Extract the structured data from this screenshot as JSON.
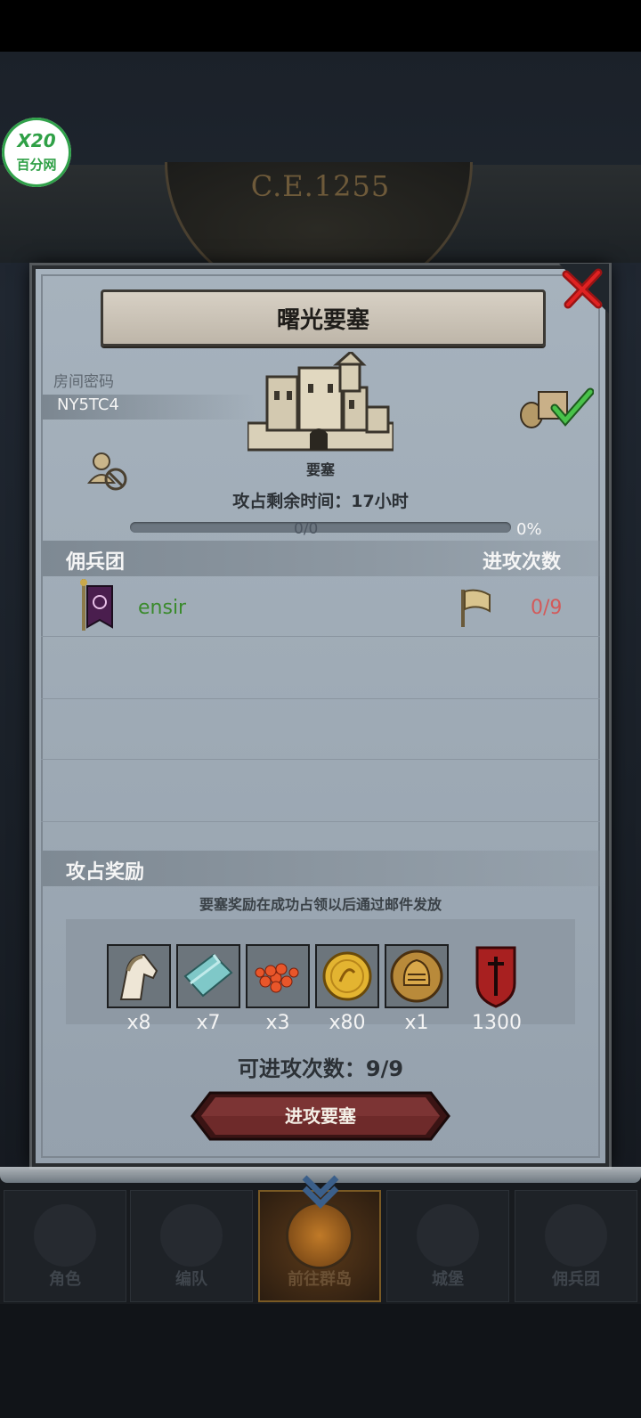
{
  "watermark": {
    "line1": "X20",
    "line2": "百分网"
  },
  "header": {
    "year": "C.E.1255"
  },
  "dialog": {
    "title": "曙光要塞",
    "room_label": "房间密码",
    "room_code": "NY5TC4",
    "building_label": "要塞",
    "time_remaining": "攻占剩余时间：17小时",
    "progress_text": "0/0",
    "progress_percent": "0%",
    "progress_value": 0,
    "mercenary_header": "佣兵团",
    "attack_count_header": "进攻次数",
    "mercenaries": [
      {
        "name": "ensir",
        "attacks": "0/9"
      }
    ],
    "reward_header": "攻占奖励",
    "reward_note": "要塞奖励在成功占领以后通过邮件发放",
    "rewards": [
      {
        "icon": "horse-icon",
        "qty": "x8"
      },
      {
        "icon": "cloth-icon",
        "qty": "x7"
      },
      {
        "icon": "caviar-icon",
        "qty": "x3"
      },
      {
        "icon": "gold-coin-icon",
        "qty": "x80"
      },
      {
        "icon": "helmet-icon",
        "qty": "x1"
      },
      {
        "icon": "shield-badge-icon",
        "qty": "1300"
      }
    ],
    "attacks_available": "可进攻次数：9/9",
    "attack_button": "进攻要塞"
  },
  "nav": [
    {
      "label": "角色",
      "active": false
    },
    {
      "label": "编队",
      "active": false
    },
    {
      "label": "前往群岛",
      "active": true
    },
    {
      "label": "城堡",
      "active": false
    },
    {
      "label": "佣兵团",
      "active": false
    }
  ],
  "colors": {
    "accent_green": "#3a8a2c",
    "count_red": "#d35a5a",
    "button_red": "#6e2a2a"
  }
}
